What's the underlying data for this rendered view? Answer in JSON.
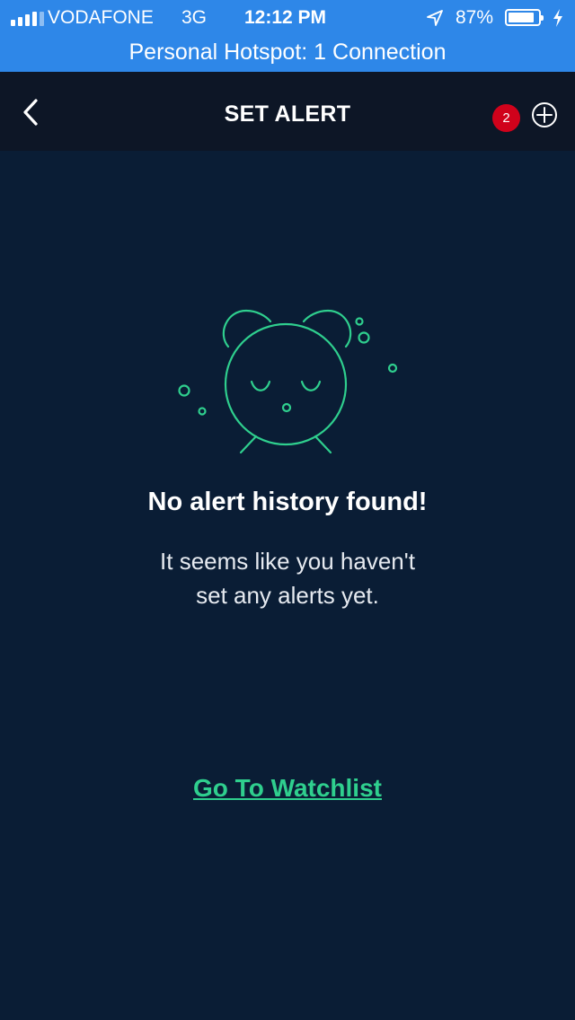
{
  "status_bar": {
    "carrier": "VODAFONE",
    "network": "3G",
    "time": "12:12 PM",
    "battery_percent": "87%",
    "battery_level": 0.87,
    "hotspot": "Personal Hotspot: 1 Connection",
    "icons": [
      "signal-icon",
      "location-arrow-icon",
      "battery-icon",
      "charging-bolt-icon"
    ]
  },
  "nav": {
    "title": "SET ALERT",
    "badge_count": "2",
    "back_icon": "chevron-left-icon",
    "add_icon": "plus-circle-icon"
  },
  "empty_state": {
    "icon": "sleeping-alarm-clock-icon",
    "title": "No alert history found!",
    "line1": "It seems like you haven't",
    "line2": "set any alerts yet.",
    "cta": "Go To Watchlist"
  },
  "colors": {
    "status_bar_bg": "#2e87e8",
    "nav_bg": "#0d1626",
    "page_bg": "#0a1d35",
    "accent_green": "#2fcf8e",
    "badge_red": "#d0021b"
  }
}
